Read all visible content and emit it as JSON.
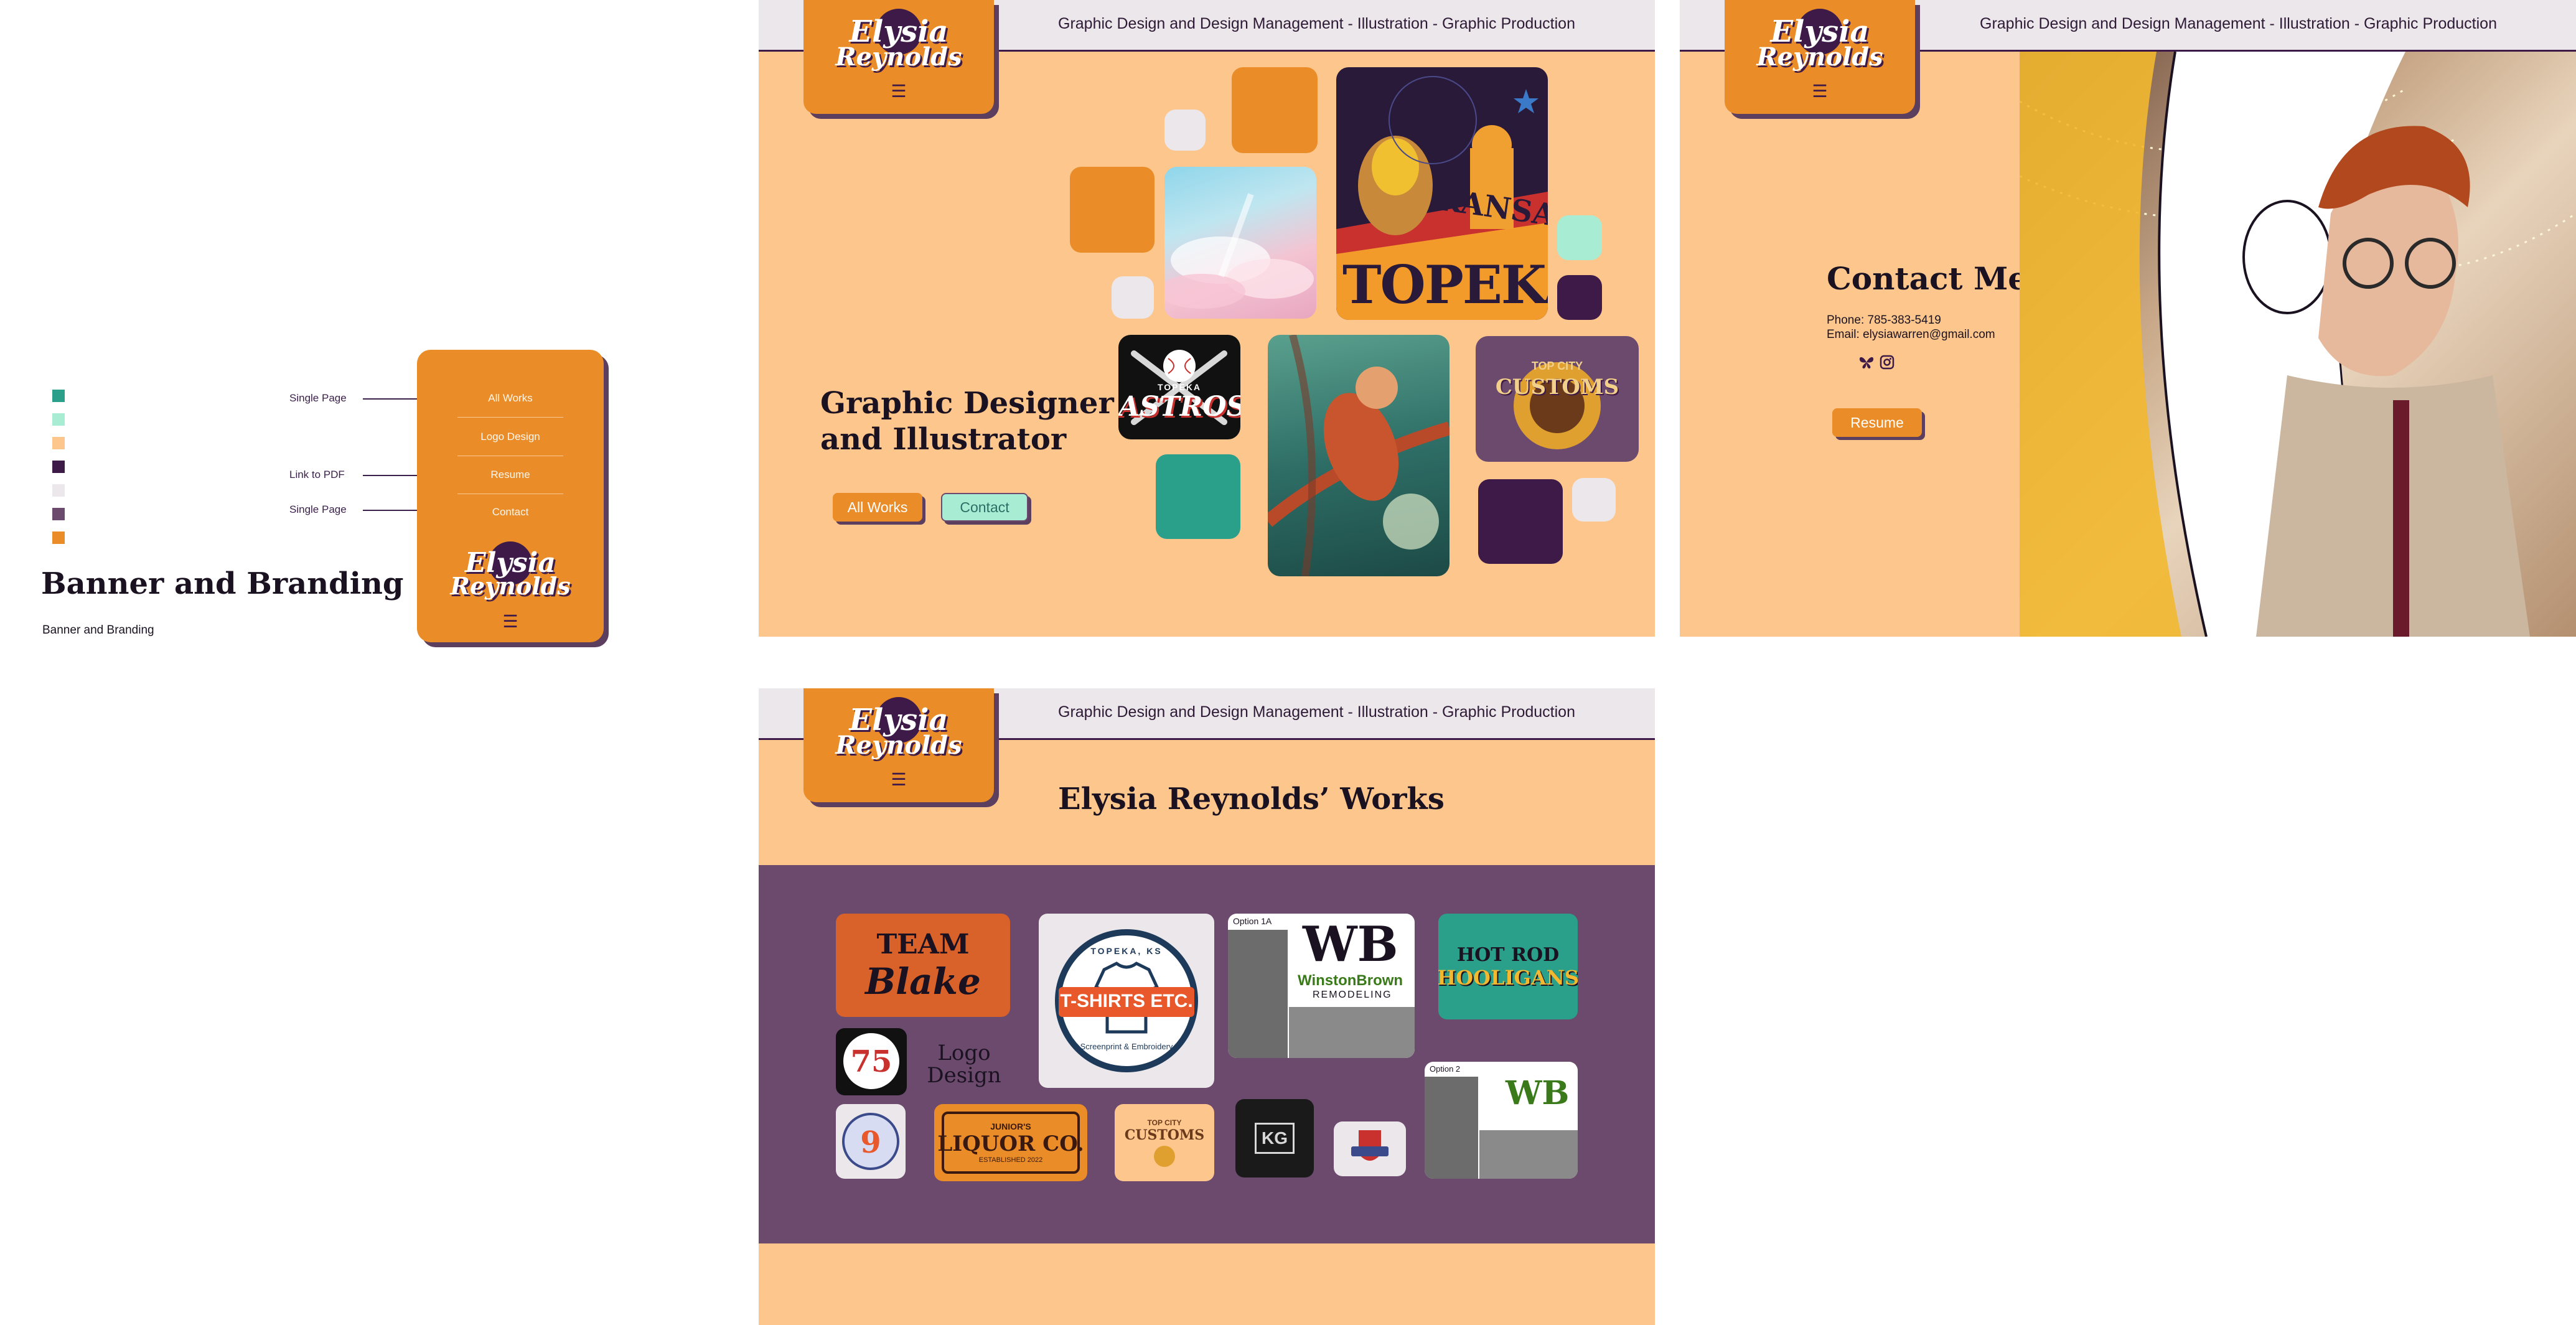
{
  "style_guide": {
    "swatches": [
      "#2aa08b",
      "#a9ecd4",
      "#fcc68d",
      "#3d1a48",
      "#ebe7ea",
      "#6b4a6d",
      "#ea8c27"
    ],
    "title": "Banner and Branding",
    "subtitle": "Banner and Branding",
    "annotations": [
      "Single Page",
      "Link to PDF",
      "Single Page"
    ],
    "menu_items": [
      "All Works",
      "Logo Design",
      "Resume",
      "Contact"
    ]
  },
  "brand": {
    "logo_line1": "Elysia",
    "logo_line2": "Reynolds",
    "menu_icon": "☰",
    "tagline": "Graphic Design and Design Management - Illustration - Graphic Production"
  },
  "home": {
    "headline_line1": "Graphic Designer",
    "headline_line2": "and Illustrator",
    "btn_all_works": "All Works",
    "btn_contact": "Contact",
    "art": {
      "kansas_top": "KANSAS",
      "kansas_bottom": "TOPEKA",
      "astros_top": "TOPEKA",
      "astros_main": "ASTROS",
      "customs_top": "TOP CITY",
      "customs_main": "CUSTOMS"
    }
  },
  "contact": {
    "heading": "Contact Me",
    "phone": "Phone: 785-383-5419",
    "email": "Email: elysiawarren@gmail.com",
    "social_icons": [
      "butterfly-icon",
      "instagram-icon"
    ],
    "btn_resume": "Resume"
  },
  "works": {
    "heading": "Elysia Reynolds’ Works",
    "section_line1": "Logo",
    "section_line2": "Design",
    "logos": {
      "team_blake_1": "TEAM",
      "team_blake_2": "Blake",
      "tshirts_top": "TOPEKA, KS",
      "tshirts_main": "T-SHIRTS ETC.",
      "tshirts_sub": "Screenprint & Embroidery",
      "wb_option_1": "Option 1A",
      "wb_option_2": "Option 2",
      "wb_mark": "WB",
      "wb_name": "WinstonBrown",
      "wb_sub": "REMODELING",
      "hotrod_1": "HOT ROD",
      "hotrod_2": "HOOLIGANS",
      "badge_75": "75",
      "liquor_top": "JUNIOR'S",
      "liquor_main": "LIQUOR CO.",
      "liquor_sub": "ESTABLISHED 2022",
      "customs_top": "TOP CITY",
      "customs_main": "CUSTOMS",
      "kg": "KG"
    }
  }
}
